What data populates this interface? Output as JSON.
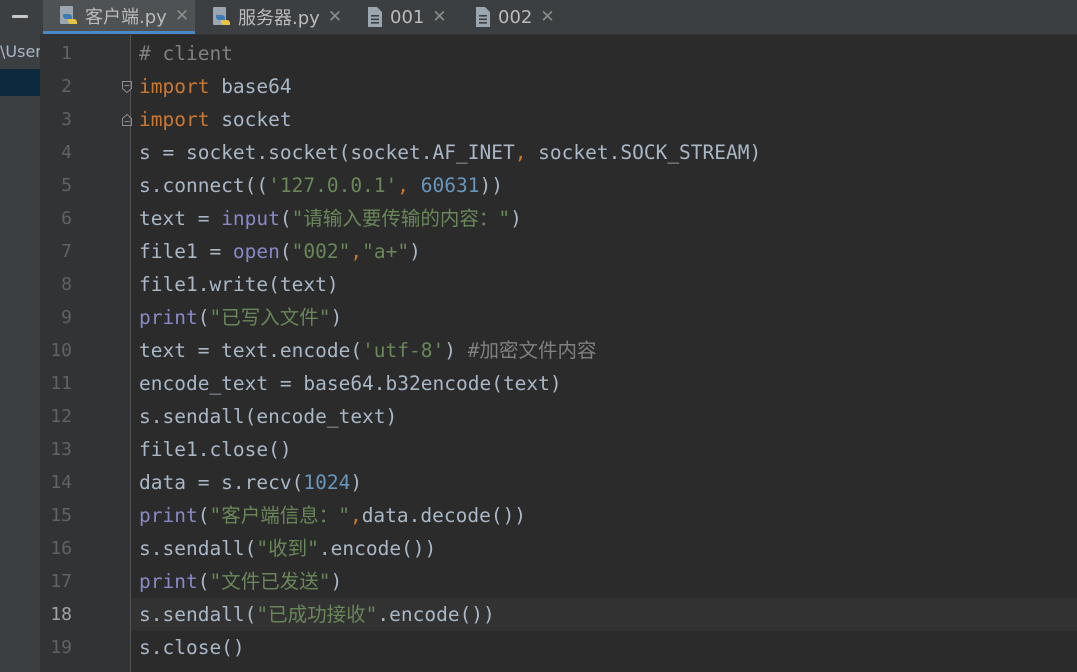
{
  "left_strip": {
    "path_fragment": "\\User"
  },
  "tabs": [
    {
      "label": "客户端.py",
      "icon": "python-file-icon",
      "active": true
    },
    {
      "label": "服务器.py",
      "icon": "python-file-icon",
      "active": false
    },
    {
      "label": "001",
      "icon": "text-file-icon",
      "active": false
    },
    {
      "label": "002",
      "icon": "text-file-icon",
      "active": false
    }
  ],
  "editor": {
    "current_line": 18,
    "line_numbers": [
      "1",
      "2",
      "3",
      "4",
      "5",
      "6",
      "7",
      "8",
      "9",
      "10",
      "11",
      "12",
      "13",
      "14",
      "15",
      "16",
      "17",
      "18",
      "19"
    ],
    "lines": [
      "# client",
      "import base64",
      "import socket",
      "s = socket.socket(socket.AF_INET, socket.SOCK_STREAM)",
      "s.connect(('127.0.0.1', 60631))",
      "text = input(\"请输入要传输的内容：\")",
      "file1 = open(\"002\",\"a+\")",
      "file1.write(text)",
      "print(\"已写入文件\")",
      "text = text.encode('utf-8') #加密文件内容",
      "encode_text = base64.b32encode(text)",
      "s.sendall(encode_text)",
      "file1.close()",
      "data = s.recv(1024)",
      "print(\"客户端信息：\",data.decode())",
      "s.sendall(\"收到\".encode())",
      "print(\"文件已发送\")",
      "s.sendall(\"已成功接收\".encode())",
      "s.close()"
    ]
  },
  "colors": {
    "keyword": "#cc7832",
    "string": "#6a8759",
    "number": "#6897bb",
    "builtin": "#8888c6",
    "comment": "#808080",
    "default": "#a9b7c6",
    "tab_active_underline": "#4a88c7"
  }
}
